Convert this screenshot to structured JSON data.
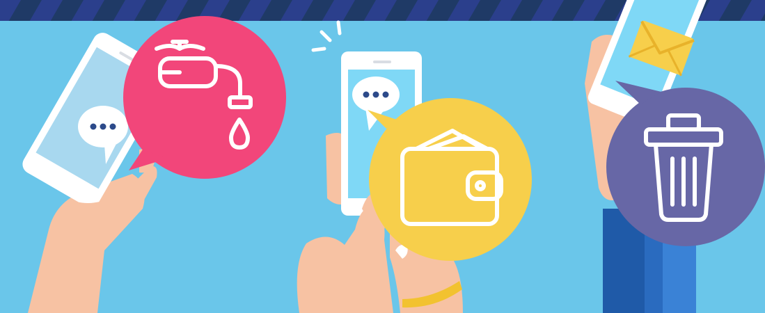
{
  "scene": {
    "colors": {
      "background": "#6ac6ea",
      "top_stripe_dark": "#1f3a66",
      "top_stripe_light": "#2c3f8a",
      "bubble_pink": "#f2467a",
      "bubble_yellow": "#f7cf4b",
      "bubble_purple": "#6767a6",
      "skin": "#f7c2a3",
      "sleeve_blue": "#2a6bbf",
      "phone_screen": "#7fd8f6"
    },
    "icons": [
      "water-tap-icon",
      "wallet-icon",
      "trash-bin-icon",
      "envelope-icon",
      "chat-dots-icon",
      "notification-burst-icon",
      "bracelet"
    ]
  }
}
